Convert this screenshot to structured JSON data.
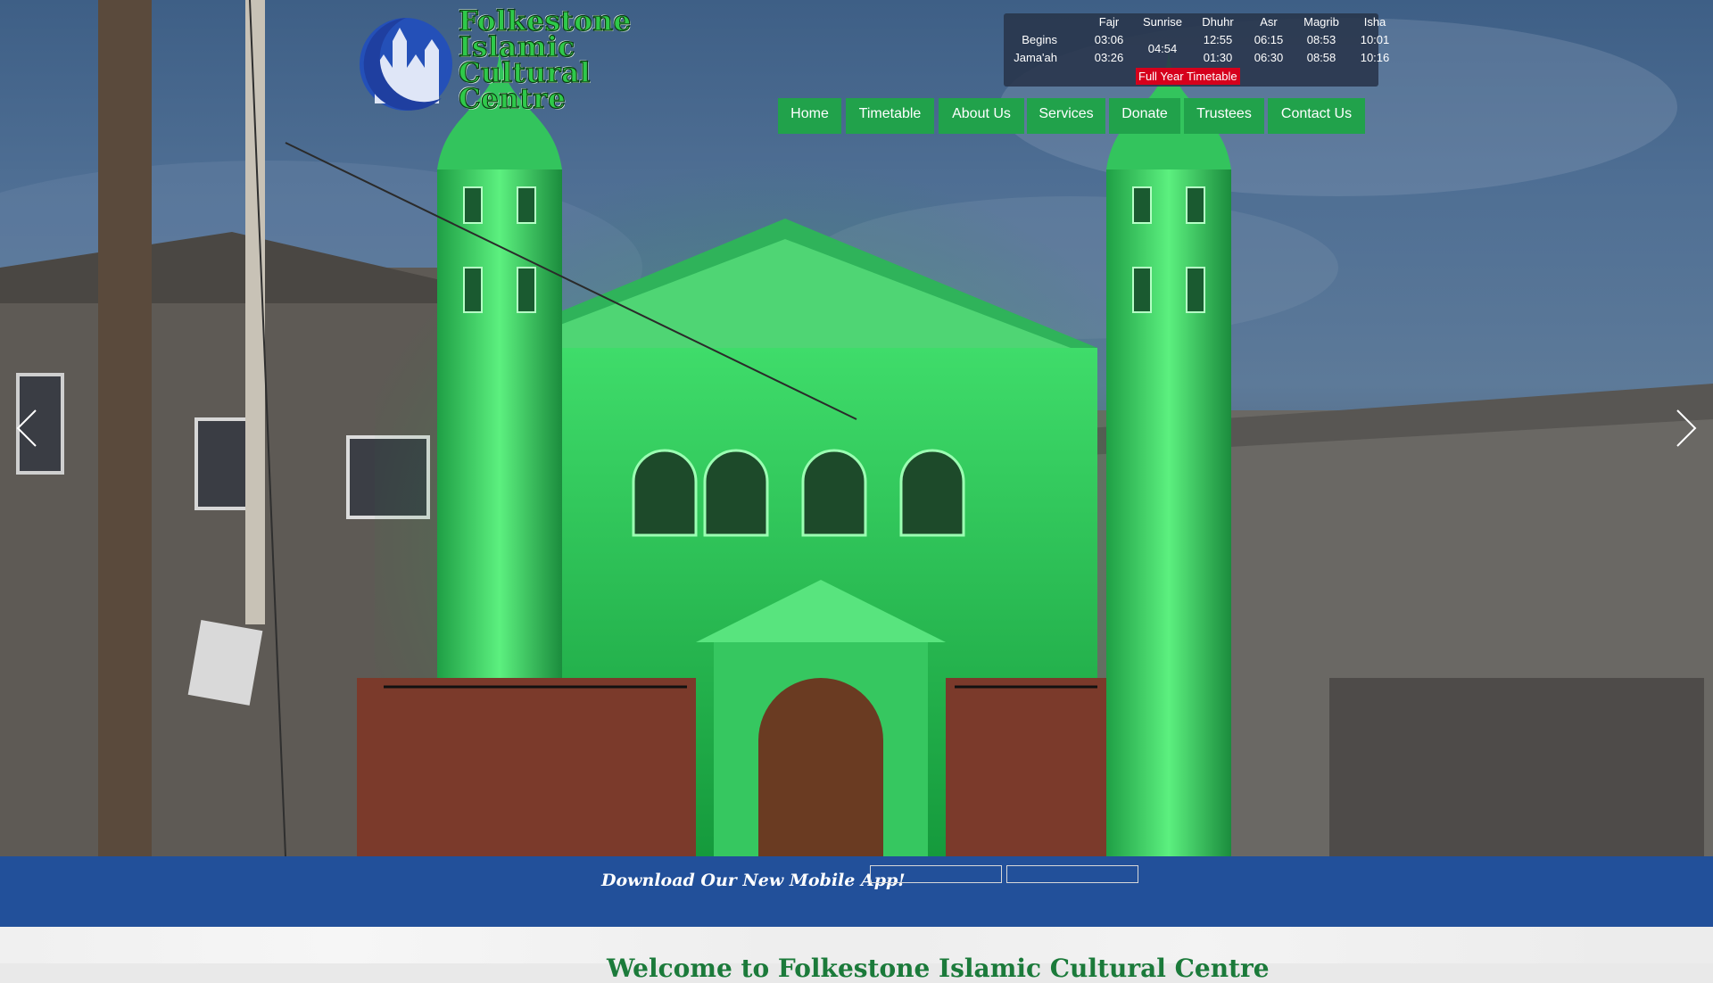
{
  "logo": {
    "text_lines": "Folkestone\nIslamic\nCultural\nCentre"
  },
  "prayer_times": {
    "columns": [
      "Fajr",
      "Sunrise",
      "Dhuhr",
      "Asr",
      "Magrib",
      "Isha"
    ],
    "begins_label": "Begins",
    "jamaah_label": "Jama'ah",
    "begins": [
      "03:06",
      "12:55",
      "06:15",
      "08:53",
      "10:01"
    ],
    "jamaah": [
      "03:26",
      "01:30",
      "06:30",
      "08:58",
      "10:16"
    ],
    "sunrise": "04:54",
    "full_year_button": "Full Year Timetable"
  },
  "nav": {
    "items": [
      "Home",
      "Timetable",
      "About Us",
      "Services",
      "Donate",
      "Trustees",
      "Contact Us"
    ]
  },
  "carousel": {
    "prev_icon": "chevron-left-icon",
    "next_icon": "chevron-right-icon"
  },
  "app_band": {
    "text": "Download Our New Mobile App!"
  },
  "welcome": {
    "text": "Welcome to Folkestone Islamic Cultural Centre"
  },
  "colors": {
    "nav_green": "#21a24b",
    "app_band_blue": "#22509a",
    "timetable_red": "#d6001c",
    "mosque_green": "#2ee36a"
  }
}
